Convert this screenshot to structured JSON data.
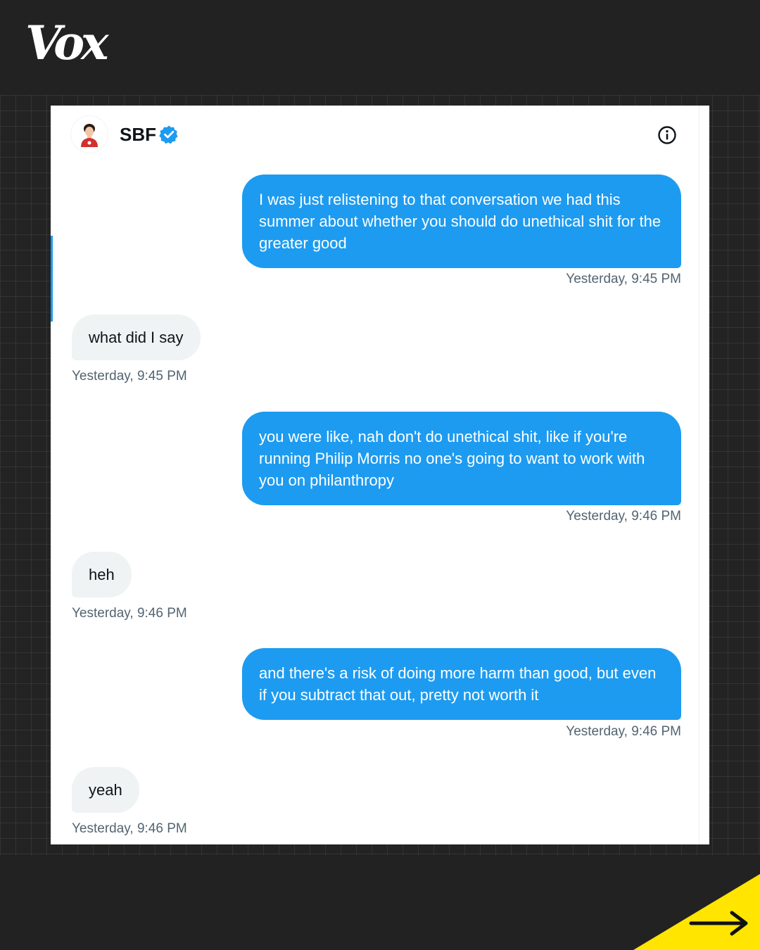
{
  "brand": {
    "logo_text": "Vox",
    "accent_color": "#ffe500"
  },
  "conversation": {
    "contact_name": "SBF",
    "verified_icon": "verified-badge-icon",
    "info_icon": "info-icon",
    "bubble_color": "#1d9bf0"
  },
  "messages": [
    {
      "direction": "outgoing",
      "text": "I was just relistening to that conversation we had this summer about whether you should do unethical shit for the greater good",
      "time": "Yesterday, 9:45 PM"
    },
    {
      "direction": "incoming",
      "text": "what did I say",
      "time": "Yesterday, 9:45 PM"
    },
    {
      "direction": "outgoing",
      "text": "you were like, nah don't do unethical shit, like if you're running Philip Morris no one's going to want to work with you on philanthropy",
      "time": "Yesterday, 9:46 PM"
    },
    {
      "direction": "incoming",
      "text": "heh",
      "time": "Yesterday, 9:46 PM"
    },
    {
      "direction": "outgoing",
      "text": "and there's a risk of doing more harm than good, but even if you subtract that out, pretty not worth it",
      "time": "Yesterday, 9:46 PM"
    },
    {
      "direction": "incoming",
      "text": "yeah",
      "time": "Yesterday, 9:46 PM"
    }
  ],
  "navigation": {
    "next_icon": "arrow-right-icon"
  }
}
